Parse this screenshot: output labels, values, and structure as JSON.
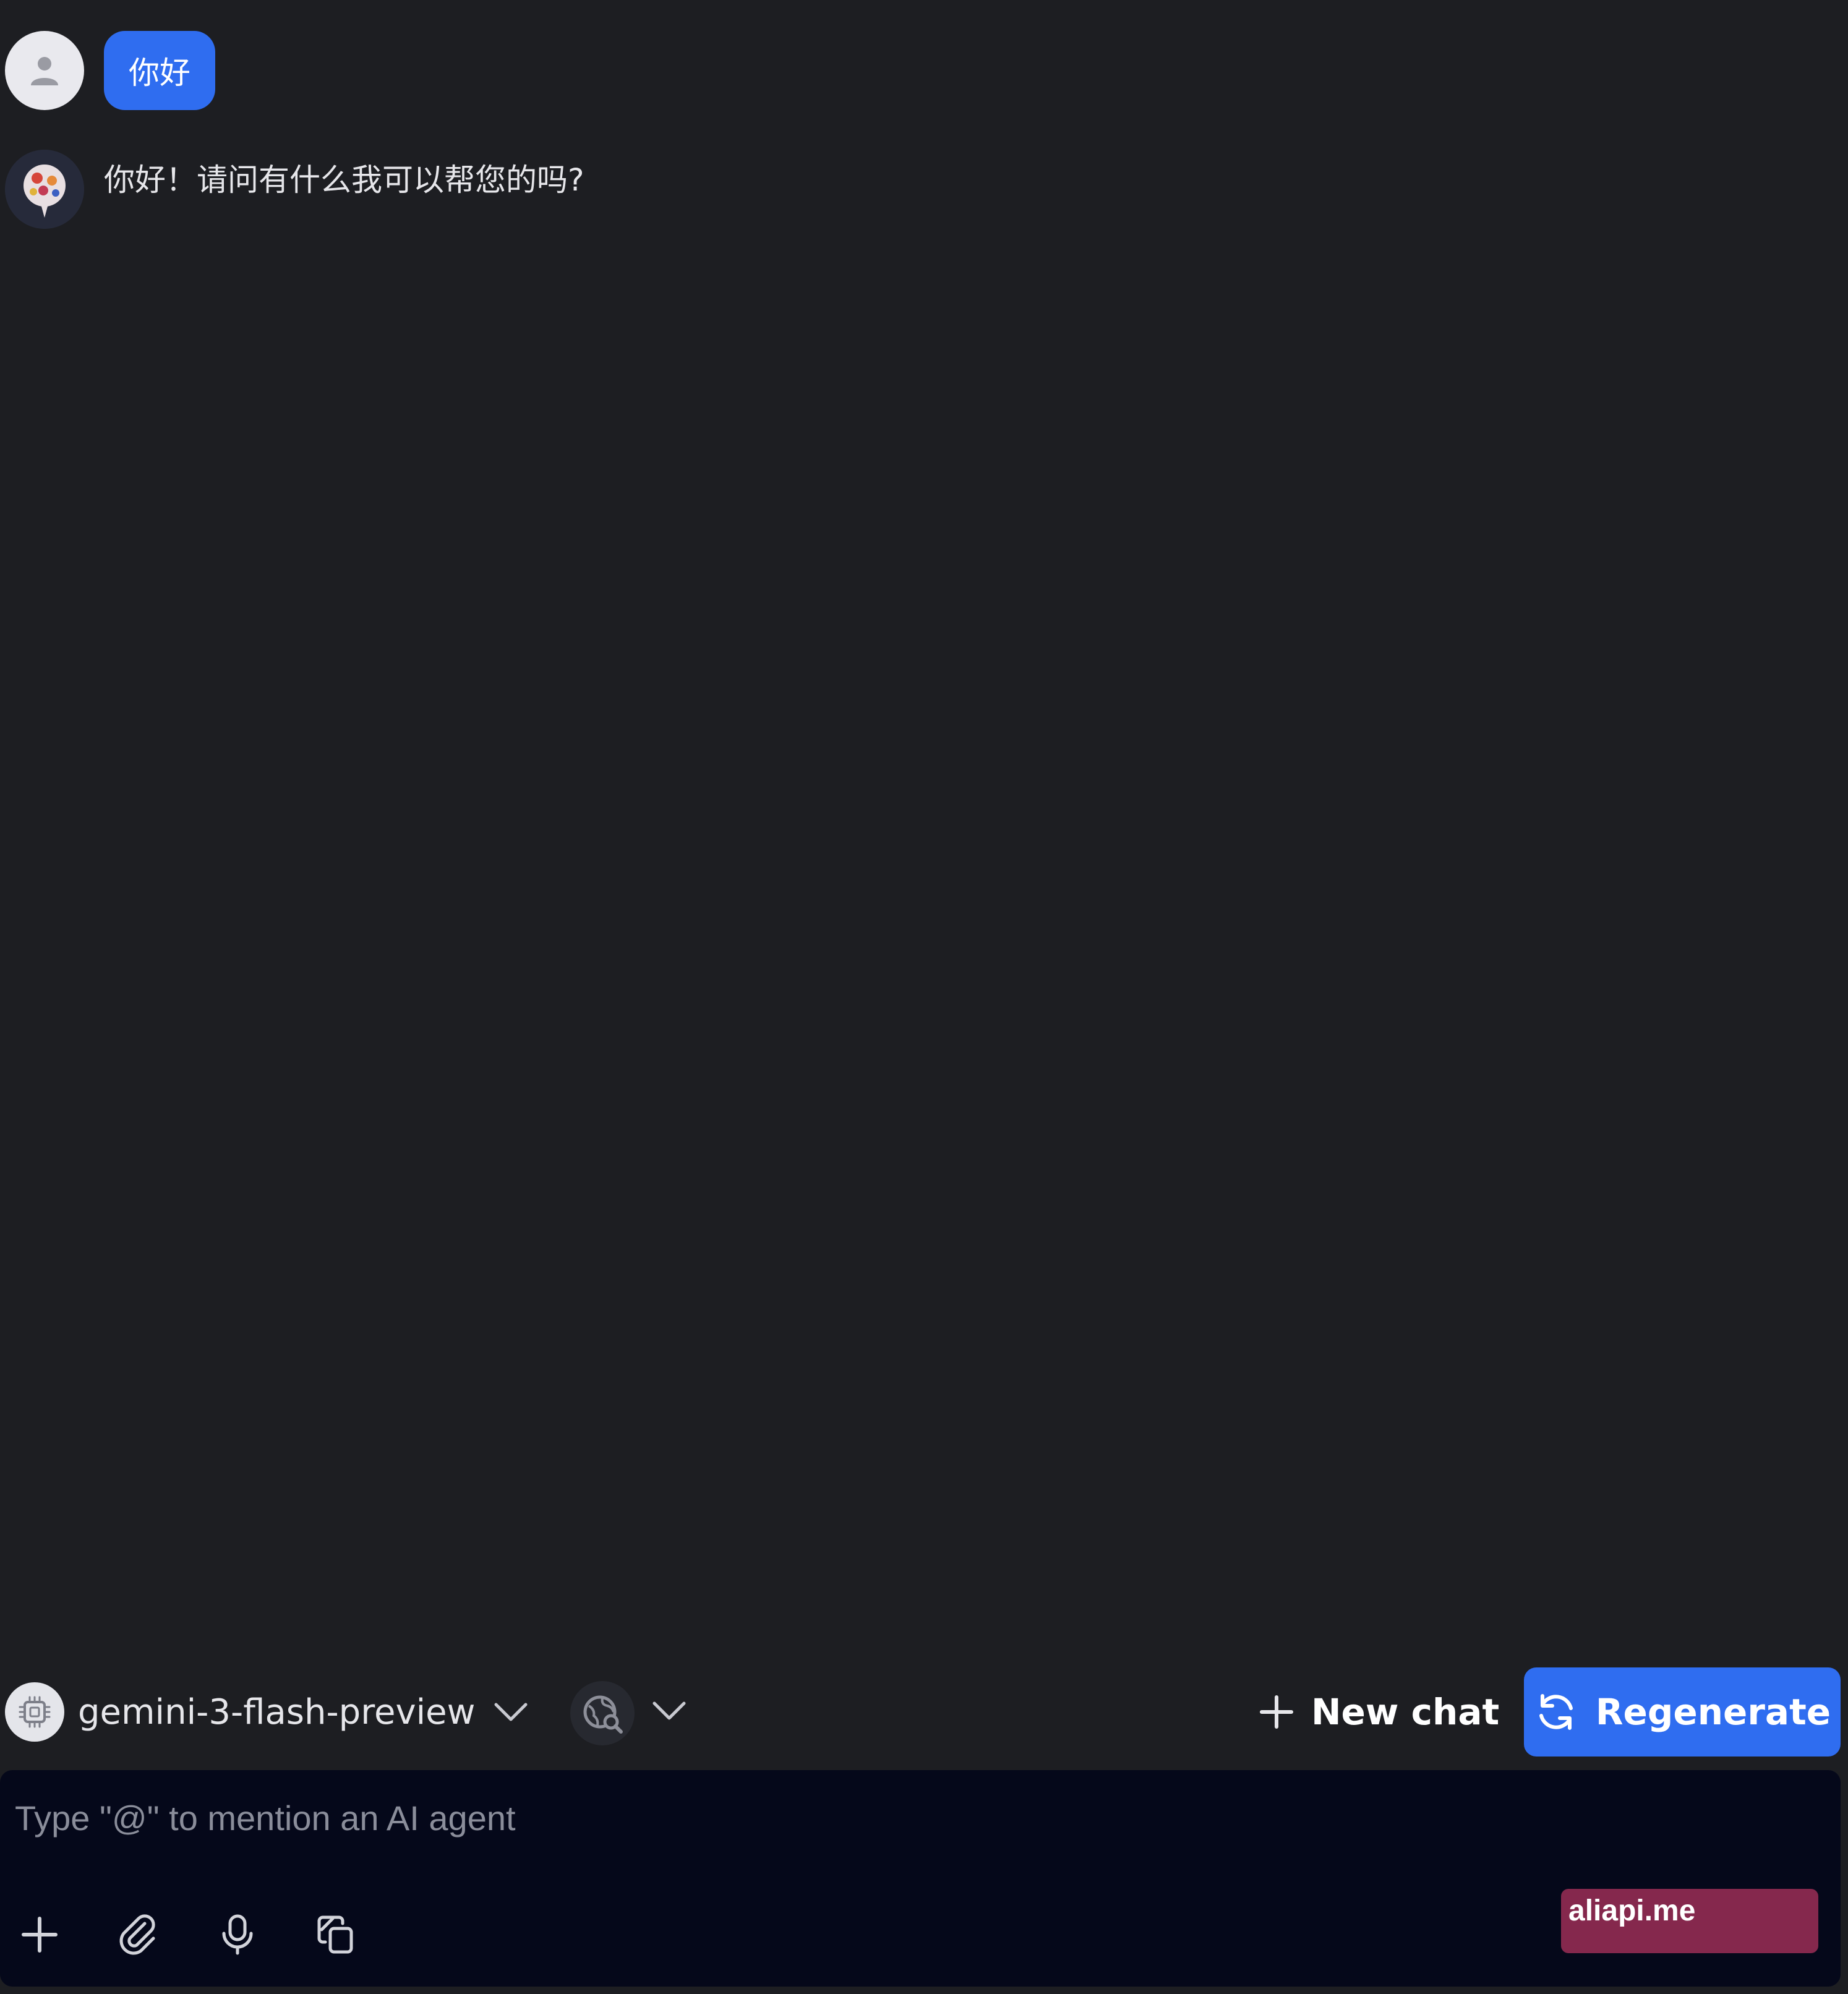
{
  "conversation": {
    "user_message": "你好",
    "bot_message": "你好！请问有什么我可以帮您的吗?"
  },
  "toolbar": {
    "model_name": "gemini-3-flash-preview",
    "new_chat_label": "New chat",
    "regenerate_label": "Regenerate"
  },
  "composer": {
    "placeholder": "Type \"@\" to mention an AI agent",
    "value": ""
  },
  "watermark": "aliapi.me",
  "colors": {
    "background": "#1d1e22",
    "accent": "#2f6df0",
    "composer_bg": "#05081a",
    "watermark_bg": "#85284d"
  },
  "icons": {
    "user_avatar": "person-icon",
    "bot_avatar": "bot-avatar-icon",
    "model": "chip-icon",
    "web_search": "globe-search-icon",
    "new_chat": "plus-icon",
    "regenerate": "refresh-icon",
    "attach": "paperclip-icon",
    "voice": "microphone-icon",
    "copy": "copy-icon"
  }
}
